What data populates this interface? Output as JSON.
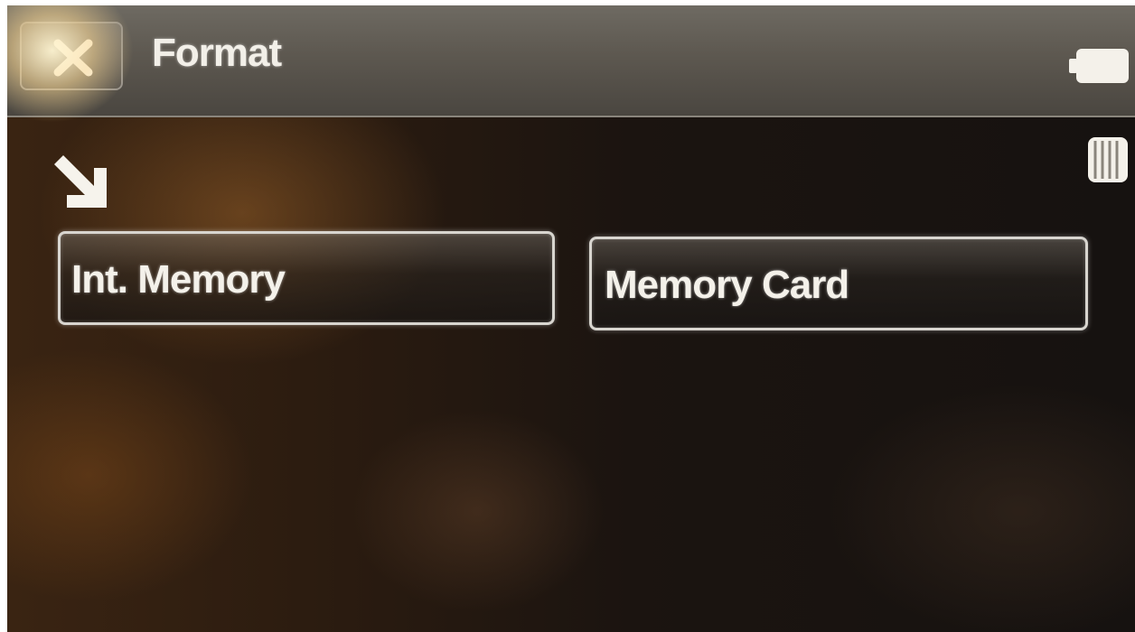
{
  "header": {
    "title": "Format",
    "close_icon": "close-icon",
    "battery_icon": "battery-icon"
  },
  "status": {
    "card_icon": "memory-card-icon"
  },
  "pointer_icon": "arrow-down-right-icon",
  "options": [
    {
      "label": "Int. Memory"
    },
    {
      "label": "Memory Card"
    }
  ]
}
